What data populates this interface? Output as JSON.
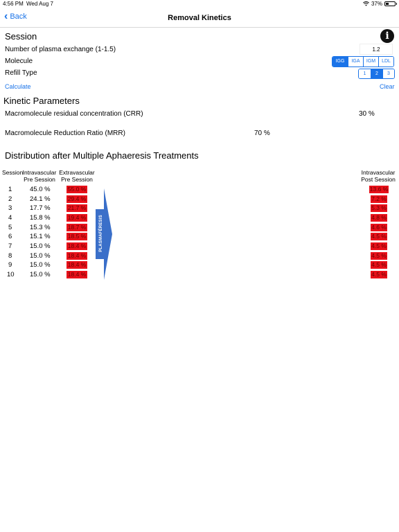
{
  "status_bar": {
    "time": "4:56 PM",
    "date": "Wed Aug 7",
    "battery": "37%"
  },
  "nav": {
    "back_label": "Back",
    "title": "Removal Kinetics"
  },
  "session": {
    "heading": "Session",
    "plasma_label": "Number of plasma exchange (1-1.5)",
    "plasma_value": "1.2",
    "molecule_label": "Molecule",
    "molecule_options": [
      "IGG",
      "IGA",
      "IGM",
      "LDL"
    ],
    "molecule_selected": "IGG",
    "refill_label": "Refill Type",
    "refill_options": [
      "1",
      "2",
      "3"
    ],
    "refill_selected": "2",
    "calculate_label": "Calculate",
    "clear_label": "Clear"
  },
  "kinetic": {
    "heading": "Kinetic Parameters",
    "crr_label": "Macromolecule residual concentration (CRR)",
    "crr_value": "30 %",
    "mrr_label": "Macromolecule Reduction Ratio (MRR)",
    "mrr_value": "70 %"
  },
  "distribution": {
    "heading": "Distribution after Multiple Aphaeresis Treatments",
    "col_session": "Session",
    "col_intra_pre": [
      "Intravascular",
      "Pre Session"
    ],
    "col_extra_pre": [
      "Extravascular",
      "Pre Session"
    ],
    "col_intra_post": [
      "Intravascular",
      "Post Session"
    ],
    "arrow_label": "PLASMAFÉRESIS",
    "rows": [
      {
        "session": "1",
        "intra_pre": "45.0 %",
        "extra_pre": "55.0 %",
        "intra_post": "13.6 %"
      },
      {
        "session": "2",
        "intra_pre": "24.1 %",
        "extra_pre": "29.4 %",
        "intra_post": "7.2 %"
      },
      {
        "session": "3",
        "intra_pre": "17.7 %",
        "extra_pre": "21.7 %",
        "intra_post": "5.3 %"
      },
      {
        "session": "4",
        "intra_pre": "15.8 %",
        "extra_pre": "19.4 %",
        "intra_post": "4.8 %"
      },
      {
        "session": "5",
        "intra_pre": "15.3 %",
        "extra_pre": "18.7 %",
        "intra_post": "4.6 %"
      },
      {
        "session": "6",
        "intra_pre": "15.1 %",
        "extra_pre": "18.5 %",
        "intra_post": "4.5 %"
      },
      {
        "session": "7",
        "intra_pre": "15.0 %",
        "extra_pre": "18.4 %",
        "intra_post": "4.5 %"
      },
      {
        "session": "8",
        "intra_pre": "15.0 %",
        "extra_pre": "18.4 %",
        "intra_post": "4.5 %"
      },
      {
        "session": "9",
        "intra_pre": "15.0 %",
        "extra_pre": "18.4 %",
        "intra_post": "4.5 %"
      },
      {
        "session": "10",
        "intra_pre": "15.0 %",
        "extra_pre": "18.4 %",
        "intra_post": "4.5 %"
      }
    ]
  },
  "colors": {
    "accent": "#1a73e8",
    "highlight": "#e8111a",
    "arrow": "#3a6fc9"
  },
  "icons": {
    "info": "info-circle-icon",
    "back": "chevron-left-icon",
    "wifi": "wifi-icon",
    "battery": "battery-icon"
  }
}
